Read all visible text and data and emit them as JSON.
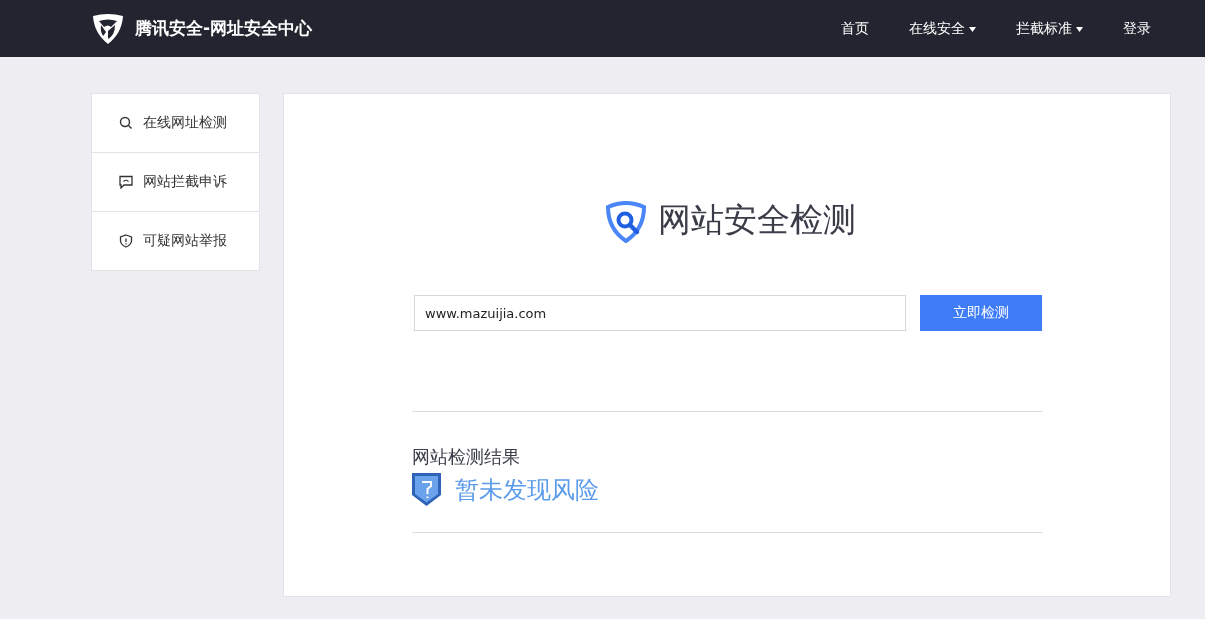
{
  "header": {
    "site_title": "腾讯安全-网址安全中心",
    "nav": [
      {
        "label": "首页",
        "dropdown": false
      },
      {
        "label": "在线安全",
        "dropdown": true
      },
      {
        "label": "拦截标准",
        "dropdown": true
      },
      {
        "label": "登录",
        "dropdown": false
      }
    ]
  },
  "sidebar": {
    "items": [
      {
        "label": "在线网址检测",
        "kind": "search"
      },
      {
        "label": "网站拦截申诉",
        "kind": "comment"
      },
      {
        "label": "可疑网站举报",
        "kind": "shield"
      }
    ]
  },
  "main": {
    "title": "网站安全检测",
    "url_field": {
      "value": "www.mazuijia.com"
    },
    "check_button": "立即检测",
    "result": {
      "heading": "网站检测结果",
      "status": "暂未发现风险"
    }
  }
}
